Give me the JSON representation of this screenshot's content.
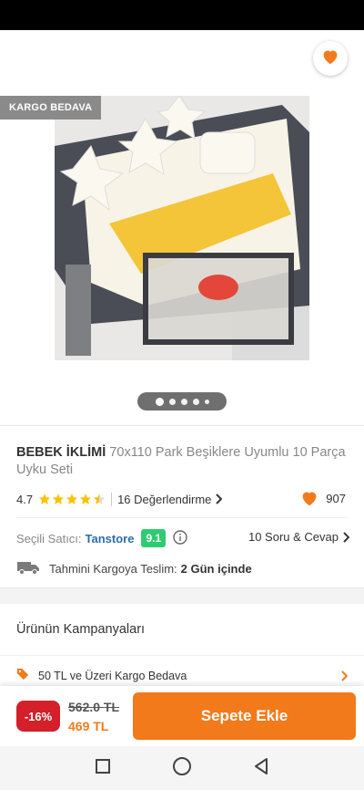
{
  "header": {
    "back_icon": "arrow-left-icon",
    "share_icon": "share-icon",
    "favorite_icon": "heart-icon",
    "accent_color": "#f27a1a"
  },
  "gallery": {
    "badge": "KARGO BEDAVA",
    "image_count": 5,
    "active_index": 0
  },
  "product": {
    "brand": "BEBEK İKLİMİ",
    "name": " 70x110 Park Beşiklere Uyumlu 10 Parça Uyku Seti",
    "rating": "4.7",
    "stars_filled": 4.5,
    "reviews": "16 Değerlendirme",
    "likes": "907"
  },
  "seller": {
    "label": "Seçili Satıcı:",
    "name": "Tanstore",
    "score": "9.1",
    "score_color": "#2ecc71",
    "qa": "10 Soru & Cevap"
  },
  "shipping": {
    "label": "Tahmini Kargoya Teslim:",
    "value": "2 Gün içinde"
  },
  "campaigns": {
    "title": "Ürünün Kampanyaları",
    "items": [
      {
        "label": "50 TL ve Üzeri Kargo Bedava"
      }
    ]
  },
  "purchase": {
    "discount": "-16%",
    "old_price": "562.0 TL",
    "new_price": "469 TL",
    "button": "Sepete Ekle",
    "discount_color": "#d3202a"
  },
  "navbar": {
    "items": [
      "recents-icon",
      "home-icon",
      "back-triangle-icon"
    ]
  }
}
